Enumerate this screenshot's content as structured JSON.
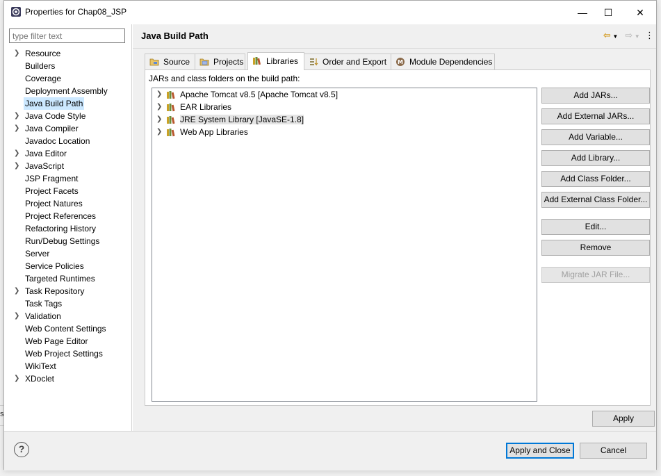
{
  "window": {
    "title": "Properties for Chap08_JSP",
    "controls": {
      "minimize": "—",
      "maximize": "☐",
      "close": "✕"
    }
  },
  "filter": {
    "placeholder": "type filter text"
  },
  "sidebar": {
    "items": [
      {
        "label": "Resource",
        "expandable": true
      },
      {
        "label": "Builders",
        "expandable": false
      },
      {
        "label": "Coverage",
        "expandable": false
      },
      {
        "label": "Deployment Assembly",
        "expandable": false
      },
      {
        "label": "Java Build Path",
        "expandable": false,
        "selected": true
      },
      {
        "label": "Java Code Style",
        "expandable": true
      },
      {
        "label": "Java Compiler",
        "expandable": true
      },
      {
        "label": "Javadoc Location",
        "expandable": false
      },
      {
        "label": "Java Editor",
        "expandable": true
      },
      {
        "label": "JavaScript",
        "expandable": true
      },
      {
        "label": "JSP Fragment",
        "expandable": false
      },
      {
        "label": "Project Facets",
        "expandable": false
      },
      {
        "label": "Project Natures",
        "expandable": false
      },
      {
        "label": "Project References",
        "expandable": false
      },
      {
        "label": "Refactoring History",
        "expandable": false
      },
      {
        "label": "Run/Debug Settings",
        "expandable": false
      },
      {
        "label": "Server",
        "expandable": false
      },
      {
        "label": "Service Policies",
        "expandable": false
      },
      {
        "label": "Targeted Runtimes",
        "expandable": false
      },
      {
        "label": "Task Repository",
        "expandable": true
      },
      {
        "label": "Task Tags",
        "expandable": false
      },
      {
        "label": "Validation",
        "expandable": true
      },
      {
        "label": "Web Content Settings",
        "expandable": false
      },
      {
        "label": "Web Page Editor",
        "expandable": false
      },
      {
        "label": "Web Project Settings",
        "expandable": false
      },
      {
        "label": "WikiText",
        "expandable": false
      },
      {
        "label": "XDoclet",
        "expandable": true
      }
    ]
  },
  "main": {
    "page_title": "Java Build Path",
    "tabs": [
      {
        "label": "Source",
        "icon": "source-folder-icon"
      },
      {
        "label": "Projects",
        "icon": "projects-icon"
      },
      {
        "label": "Libraries",
        "icon": "libraries-icon",
        "active": true
      },
      {
        "label": "Order and Export",
        "icon": "order-export-icon"
      },
      {
        "label": "Module Dependencies",
        "icon": "module-icon"
      }
    ],
    "description": "JARs and class folders on the build path:",
    "libraries": [
      {
        "label": "Apache Tomcat v8.5 [Apache Tomcat v8.5]"
      },
      {
        "label": "EAR Libraries"
      },
      {
        "label": "JRE System Library [JavaSE-1.8]",
        "selected": true
      },
      {
        "label": "Web App Libraries"
      }
    ],
    "buttons": {
      "add_jars": "Add JARs...",
      "add_external_jars": "Add External JARs...",
      "add_variable": "Add Variable...",
      "add_library": "Add Library...",
      "add_class_folder": "Add Class Folder...",
      "add_external_class_folder": "Add External Class Folder...",
      "edit": "Edit...",
      "remove": "Remove",
      "migrate_jar": "Migrate JAR File..."
    },
    "apply": "Apply"
  },
  "footer": {
    "help": "?",
    "apply_close": "Apply and Close",
    "cancel": "Cancel"
  },
  "colors": {
    "selection": "#cce8ff",
    "default_button_border": "#0078d7"
  }
}
